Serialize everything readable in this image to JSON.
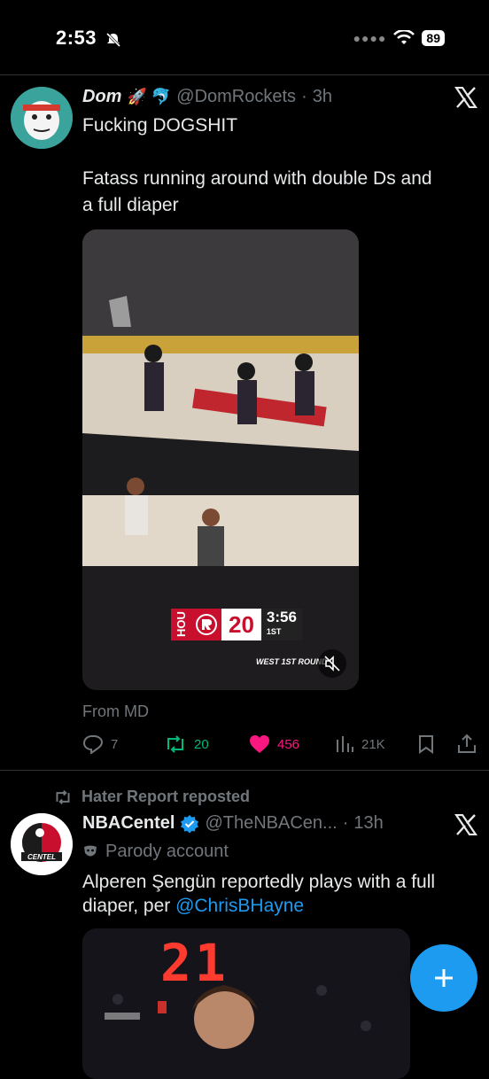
{
  "status": {
    "time": "2:53",
    "battery": "89"
  },
  "tweet1": {
    "author_name": "Dom",
    "author_emoji": "🚀 🐬",
    "handle": "@DomRockets",
    "dot": "·",
    "time": "3h",
    "text_line1": "Fucking DOGSHIT",
    "text_line2": "Fatass running around with double Ds and",
    "text_line3": "a full diaper",
    "media": {
      "score": "20",
      "clock": "3:56",
      "period": "1ST",
      "team": "HOU",
      "round": "WEST 1ST ROUND"
    },
    "source": "From MD",
    "replies": "7",
    "retweets": "20",
    "likes": "456",
    "views": "21K"
  },
  "tweet2": {
    "repost_label": "Hater Report reposted",
    "author_name": "NBACentel",
    "handle": "@TheNBACen...",
    "dot": "·",
    "time": "13h",
    "parody_label": "Parody account",
    "text_line1": "Alperen Şengün reportedly plays with a full",
    "text_prefix": "diaper, per ",
    "mention": "@ChrisBHayne",
    "media_score": "21"
  },
  "colors": {
    "accent": "#1d9bf0",
    "like": "#f91880",
    "retweet": "#00ba7c"
  }
}
